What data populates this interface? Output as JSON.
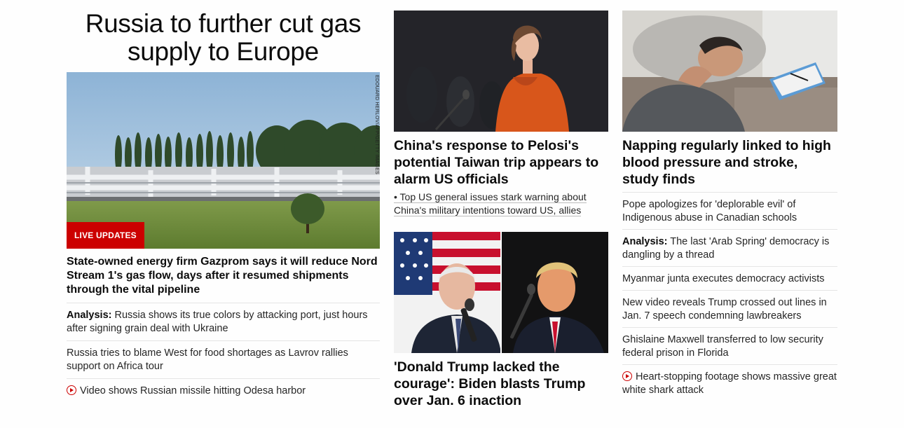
{
  "lead": {
    "banner_headline": "Russia to further cut gas supply to Europe",
    "image_credit": "EDOUARD HERLOV/AFP/GETTY IMAGES",
    "badge": "LIVE UPDATES",
    "headline": "State-owned energy firm Gazprom says it will reduce Nord Stream 1's gas flow, days after it resumed shipments through the vital pipeline",
    "items": [
      {
        "prefix": "Analysis:",
        "text": " Russia shows its true colors by attacking port, just hours after signing grain deal with Ukraine"
      },
      {
        "text": "Russia tries to blame West for food shortages as Lavrov rallies support on Africa tour"
      },
      {
        "text": "Video shows Russian missile hitting Odesa harbor",
        "icon": "play-icon"
      }
    ]
  },
  "middle": {
    "card1": {
      "headline": "China's response to Pelosi's potential Taiwan trip appears to alarm US officials",
      "bullet": "• Top US general issues stark warning about China's military intentions toward US, allies"
    },
    "card2": {
      "headline": "'Donald Trump lacked the courage': Biden blasts Trump over Jan. 6 inaction"
    }
  },
  "right": {
    "card": {
      "headline": "Napping regularly linked to high blood pressure and stroke, study finds"
    },
    "items": [
      {
        "text": "Pope apologizes for 'deplorable evil' of Indigenous abuse in Canadian schools"
      },
      {
        "prefix": "Analysis:",
        "text": " The last 'Arab Spring' democracy is dangling by a thread"
      },
      {
        "text": "Myanmar junta executes democracy activists"
      },
      {
        "text": "New video reveals Trump crossed out lines in Jan. 7 speech condemning lawbreakers"
      },
      {
        "text": "Ghislaine Maxwell transferred to low security federal prison in Florida"
      },
      {
        "text": "Heart-stopping footage shows massive great white shark attack",
        "icon": "play-icon"
      }
    ]
  },
  "colors": {
    "accent": "#cc0000",
    "text": "#0c0c0c",
    "divider": "#e5e5e5"
  }
}
